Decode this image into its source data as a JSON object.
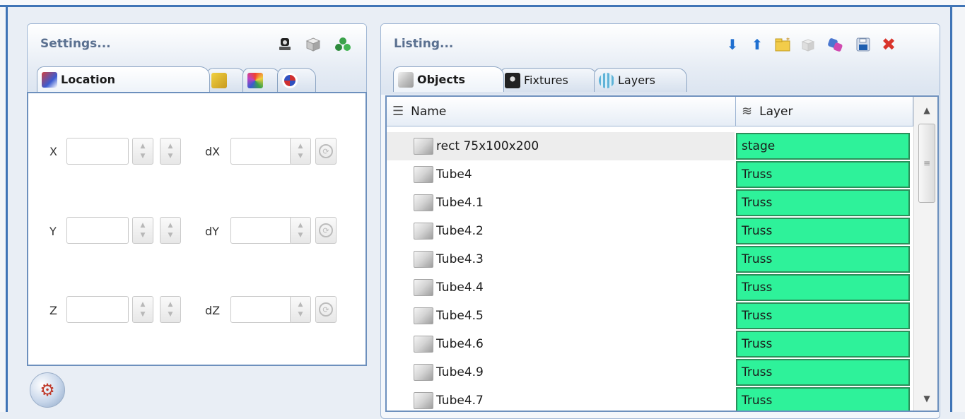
{
  "settings": {
    "title": "Settings...",
    "tabs": [
      {
        "label": "Location",
        "icon": "axes-icon"
      },
      {
        "label": "",
        "icon": "ruler-icon"
      },
      {
        "label": "",
        "icon": "color-icon"
      },
      {
        "label": "",
        "icon": "rotate-icon"
      }
    ],
    "fields": [
      {
        "label": "X",
        "delta_label": "dX",
        "value": "",
        "delta_value": ""
      },
      {
        "label": "Y",
        "delta_label": "dY",
        "value": "",
        "delta_value": ""
      },
      {
        "label": "Z",
        "delta_label": "dZ",
        "value": "",
        "delta_value": ""
      }
    ]
  },
  "listing": {
    "title": "Listing...",
    "tabs": [
      {
        "label": "Objects",
        "icon": "cube-icon"
      },
      {
        "label": "Fixtures",
        "icon": "fixture-icon"
      },
      {
        "label": "Layers",
        "icon": "layers-icon"
      }
    ],
    "columns": {
      "name": "Name",
      "layer": "Layer"
    },
    "rows": [
      {
        "name": "rect 75x100x200",
        "layer": "stage"
      },
      {
        "name": "Tube4",
        "layer": "Truss"
      },
      {
        "name": "Tube4.1",
        "layer": "Truss"
      },
      {
        "name": "Tube4.2",
        "layer": "Truss"
      },
      {
        "name": "Tube4.3",
        "layer": "Truss"
      },
      {
        "name": "Tube4.4",
        "layer": "Truss"
      },
      {
        "name": "Tube4.5",
        "layer": "Truss"
      },
      {
        "name": "Tube4.6",
        "layer": "Truss"
      },
      {
        "name": "Tube4.9",
        "layer": "Truss"
      },
      {
        "name": "Tube4.7",
        "layer": "Truss"
      }
    ]
  },
  "colors": {
    "layer_cell": "#2ef29a",
    "frame_accent": "#3f74b6",
    "toolbar_blue": "#1f6fd0",
    "delete_red": "#d9342b"
  }
}
